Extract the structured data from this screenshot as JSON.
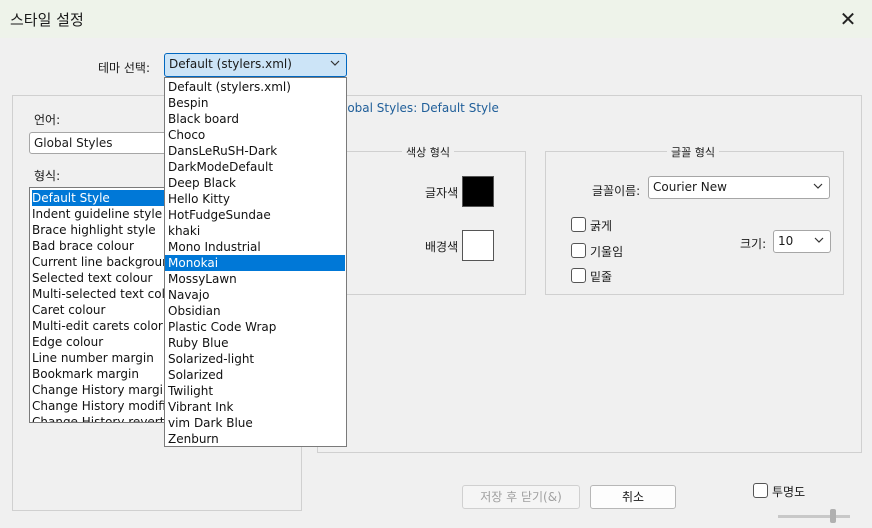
{
  "window": {
    "title": "스타일 설정",
    "close_icon": "close-icon"
  },
  "theme": {
    "label": "테마 선택:",
    "selected": "Default (stylers.xml)",
    "options": [
      "Default (stylers.xml)",
      "Bespin",
      "Black board",
      "Choco",
      "DansLeRuSH-Dark",
      "DarkModeDefault",
      "Deep Black",
      "Hello Kitty",
      "HotFudgeSundae",
      "khaki",
      "Mono Industrial",
      "Monokai",
      "MossyLawn",
      "Navajo",
      "Obsidian",
      "Plastic Code Wrap",
      "Ruby Blue",
      "Solarized-light",
      "Solarized",
      "Twilight",
      "Vibrant Ink",
      "vim Dark Blue",
      "Zenburn"
    ],
    "highlighted": "Monokai"
  },
  "language": {
    "label": "언어:",
    "value": "Global Styles"
  },
  "style": {
    "label": "형식:",
    "items": [
      "Default Style",
      "Indent guideline style",
      "Brace highlight style",
      "Bad brace colour",
      "Current line background",
      "Selected text colour",
      "Multi-selected text color",
      "Caret colour",
      "Multi-edit carets color",
      "Edge colour",
      "Line number margin",
      "Bookmark margin",
      "Change History margin",
      "Change History modified",
      "Change History revert"
    ],
    "selected": "Default Style"
  },
  "style_header": "lobal Styles: Default Style",
  "color_group": {
    "caption": "색상 형식",
    "fg_label": "글자색",
    "bg_label": "배경색",
    "fg_color": "#000000",
    "bg_color": "#ffffff"
  },
  "font_group": {
    "caption": "글꼴 형식",
    "font_label": "글꼴이름:",
    "font_value": "Courier New",
    "bold_label": "굵게",
    "italic_label": "기울임",
    "underline_label": "밑줄",
    "size_label": "크기:",
    "size_value": "10"
  },
  "buttons": {
    "save_close": "저장 후 닫기(&)",
    "cancel": "취소"
  },
  "transparency": {
    "label": "투명도"
  }
}
